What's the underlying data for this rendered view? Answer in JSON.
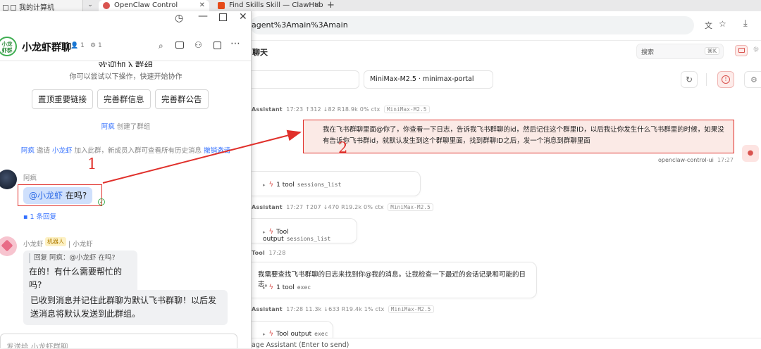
{
  "browser": {
    "left_tab_label": "我的计算机",
    "tabs": [
      {
        "label": "OpenClaw Control",
        "color": "#d9534f"
      },
      {
        "label": "Find Skills Skill — ClawHub",
        "color": "#e64a19"
      }
    ],
    "new_tab_icon": "+",
    "address": "agent%3Amain%3Amain"
  },
  "app": {
    "title_partial": "聊天",
    "search_placeholder": "搜索",
    "search_shortcut": "⌘K",
    "session_input_value": "",
    "model_select_value": "MiniMax-M2.5 · minimax-portal",
    "footer_input_placeholder": "age Assistant (Enter to send)",
    "client_label": "openclaw-control-ui",
    "client_time": "17:27"
  },
  "messages": [
    {
      "sender": "Assistant",
      "meta": "17:23  ↑312  ↓82  R18.9k  0% ctx",
      "model": "MiniMax-M2.5"
    },
    {
      "user_text": "我在飞书群聊里面@你了，你查看一下日志，告诉我飞书群聊的id，然后记住这个群里ID，以后我让你发生什么飞书群里的时候，如果没有告诉你飞书群id，就默认发生到这个群聊里面，找到群聊ID之后，发一个消息到群聊里面"
    },
    {
      "tool_label": "1 tool",
      "tool_sub": "sessions_list"
    },
    {
      "sender": "Assistant",
      "meta": "17:27  ↑207  ↓470  R19.2k  0% ctx",
      "model": "MiniMax-M2.5"
    },
    {
      "tool_label": "Tool output",
      "tool_sub": "sessions_list"
    },
    {
      "sender": "Tool",
      "meta": "17:28"
    },
    {
      "assistant_text": "我需要查找飞书群聊的日志来找到你@我的消息。让我检查一下最近的会话记录和可能的日志。",
      "tool_label": "1 tool",
      "tool_sub": "exec"
    },
    {
      "sender": "Assistant",
      "meta": "17:28  11.3k  ↓633  R19.4k  1% ctx",
      "model": "MiniMax-M2.5"
    },
    {
      "tool_label": "Tool output",
      "tool_sub": "exec"
    }
  ],
  "chat": {
    "group_avatar_text": "小龙\n虾群",
    "group_name": "小龙虾群聊",
    "member_count": "1",
    "bot_count": "1",
    "welcome_title": "欢迎加入群组",
    "welcome_sub": "你可以尝试以下操作，快速开始协作",
    "quick_actions": [
      "置顶重要链接",
      "完善群信息",
      "完善群公告"
    ],
    "created_user": "阿疯",
    "created_text": "创建了群组",
    "invite_user1": "阿疯",
    "invite_mid": "邀请",
    "invite_user2": "小龙虾",
    "invite_text": "加入此群，新成员入群可查看所有历史消息",
    "invite_revoke": "撤销邀请",
    "sender1": "阿疯",
    "msg1_mention": "@小龙虾",
    "msg1_text": "在吗?",
    "reply_count": "1 条回复",
    "bot_name": "小龙虾",
    "bot_tag": "机器人",
    "bot_sub": "| 小龙虾",
    "quote": "回复 阿疯：@小龙虾 在吗?",
    "bot_reply1": "在的！有什么需要帮忙的吗?",
    "bot_reply2": "已收到消息并记住此群聊为默认飞书群聊！以后发送消息将默认发送到此群组。",
    "input_placeholder": "发送给 小龙虾群聊"
  },
  "annotations": {
    "label1": "1",
    "label2": "2",
    "color": "#e0302b"
  }
}
